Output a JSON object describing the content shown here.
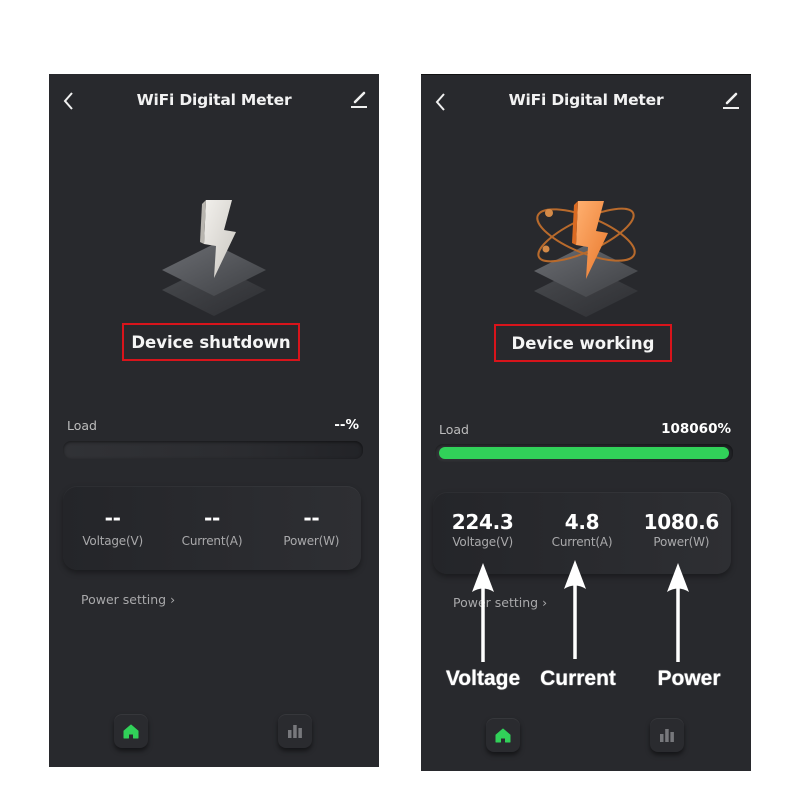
{
  "colors": {
    "background": "#28292d",
    "accent_green": "#31d159",
    "highlight_red": "#d8141b",
    "text_primary": "#ffffff",
    "text_secondary": "#a9a9ab",
    "bolt_off": "#e8e6e2",
    "bolt_on": "#f5923e"
  },
  "screens": [
    {
      "header": {
        "title": "WiFi Digital Meter",
        "back_icon": "chevron-left-icon",
        "edit_icon": "pencil-icon"
      },
      "hero": {
        "icon": "lightning-bolt-icon",
        "state": "off"
      },
      "status": "Device shutdown",
      "load": {
        "label": "Load",
        "value": "--%",
        "fill_fraction": 0
      },
      "stats": [
        {
          "value": "--",
          "label": "Voltage(V)"
        },
        {
          "value": "--",
          "label": "Current(A)"
        },
        {
          "value": "--",
          "label": "Power(W)"
        }
      ],
      "power_setting": "Power setting",
      "power_setting_chevron": "›",
      "tabs": [
        {
          "name": "home",
          "icon": "home-icon",
          "active": true
        },
        {
          "name": "statistics",
          "icon": "bar-chart-icon",
          "active": false
        }
      ]
    },
    {
      "header": {
        "title": "WiFi Digital Meter",
        "back_icon": "chevron-left-icon",
        "edit_icon": "pencil-icon"
      },
      "hero": {
        "icon": "lightning-bolt-icon",
        "state": "on"
      },
      "status": "Device working",
      "load": {
        "label": "Load",
        "value": "108060%",
        "fill_fraction": 1
      },
      "stats": [
        {
          "value": "224.3",
          "label": "Voltage(V)"
        },
        {
          "value": "4.8",
          "label": "Current(A)"
        },
        {
          "value": "1080.6",
          "label": "Power(W)"
        }
      ],
      "power_setting": "Power setting",
      "power_setting_chevron": "›",
      "tabs": [
        {
          "name": "home",
          "icon": "home-icon",
          "active": true
        },
        {
          "name": "statistics",
          "icon": "bar-chart-icon",
          "active": false
        }
      ]
    }
  ],
  "annotations": [
    {
      "label": "Voltage",
      "points_to": "voltage-stat"
    },
    {
      "label": "Current",
      "points_to": "current-stat"
    },
    {
      "label": "Power",
      "points_to": "power-stat"
    }
  ]
}
